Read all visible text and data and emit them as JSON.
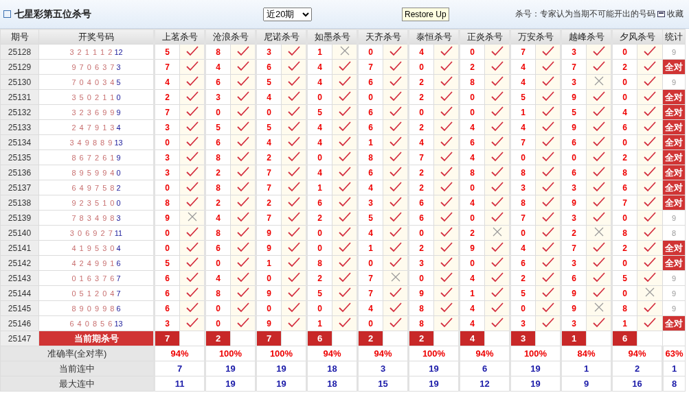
{
  "header": {
    "title": "七星彩第五位杀号",
    "period_select": "近20期",
    "restore_button": "Restore Up",
    "note": "杀号：专家认为当期不可能开出的号码",
    "favorite": "收藏"
  },
  "columns": {
    "period": "期号",
    "draw": "开奖号码",
    "experts": [
      "上茗杀号",
      "沧浪杀号",
      "尼诺杀号",
      "如墨杀号",
      "天齐杀号",
      "泰恒杀号",
      "正炎杀号",
      "万安杀号",
      "越峰杀号",
      "夕风杀号"
    ],
    "stats": "统计"
  },
  "rows": [
    {
      "period": "25128",
      "numbers": "3 2 1 1 1 2",
      "extra": "12",
      "picks": [
        {
          "kill": "5",
          "hit": true
        },
        {
          "kill": "8",
          "hit": true
        },
        {
          "kill": "3",
          "hit": true
        },
        {
          "kill": "1",
          "hit": false
        },
        {
          "kill": "0",
          "hit": true
        },
        {
          "kill": "4",
          "hit": true
        },
        {
          "kill": "0",
          "hit": true
        },
        {
          "kill": "7",
          "hit": true
        },
        {
          "kill": "3",
          "hit": true
        },
        {
          "kill": "0",
          "hit": true
        }
      ],
      "stat": {
        "kind": "count",
        "text": "9"
      }
    },
    {
      "period": "25129",
      "numbers": "9 7 0 6 3 7",
      "extra": "3",
      "picks": [
        {
          "kill": "7",
          "hit": true
        },
        {
          "kill": "4",
          "hit": true
        },
        {
          "kill": "6",
          "hit": true
        },
        {
          "kill": "4",
          "hit": true
        },
        {
          "kill": "7",
          "hit": true
        },
        {
          "kill": "0",
          "hit": true
        },
        {
          "kill": "2",
          "hit": true
        },
        {
          "kill": "4",
          "hit": true
        },
        {
          "kill": "7",
          "hit": true
        },
        {
          "kill": "2",
          "hit": true
        }
      ],
      "stat": {
        "kind": "full",
        "text": "全对"
      }
    },
    {
      "period": "25130",
      "numbers": "7 0 4 0 3 4",
      "extra": "5",
      "picks": [
        {
          "kill": "4",
          "hit": true
        },
        {
          "kill": "6",
          "hit": true
        },
        {
          "kill": "5",
          "hit": true
        },
        {
          "kill": "4",
          "hit": true
        },
        {
          "kill": "6",
          "hit": true
        },
        {
          "kill": "2",
          "hit": true
        },
        {
          "kill": "8",
          "hit": true
        },
        {
          "kill": "4",
          "hit": true
        },
        {
          "kill": "3",
          "hit": false
        },
        {
          "kill": "0",
          "hit": true
        }
      ],
      "stat": {
        "kind": "count",
        "text": "9"
      }
    },
    {
      "period": "25131",
      "numbers": "3 5 0 2 1 1",
      "extra": "0",
      "picks": [
        {
          "kill": "2",
          "hit": true
        },
        {
          "kill": "3",
          "hit": true
        },
        {
          "kill": "4",
          "hit": true
        },
        {
          "kill": "0",
          "hit": true
        },
        {
          "kill": "0",
          "hit": true
        },
        {
          "kill": "2",
          "hit": true
        },
        {
          "kill": "0",
          "hit": true
        },
        {
          "kill": "5",
          "hit": true
        },
        {
          "kill": "9",
          "hit": true
        },
        {
          "kill": "0",
          "hit": true
        }
      ],
      "stat": {
        "kind": "full",
        "text": "全对"
      }
    },
    {
      "period": "25132",
      "numbers": "3 2 3 6 9 9",
      "extra": "9",
      "picks": [
        {
          "kill": "7",
          "hit": true
        },
        {
          "kill": "0",
          "hit": true
        },
        {
          "kill": "0",
          "hit": true
        },
        {
          "kill": "5",
          "hit": true
        },
        {
          "kill": "6",
          "hit": true
        },
        {
          "kill": "0",
          "hit": true
        },
        {
          "kill": "0",
          "hit": true
        },
        {
          "kill": "1",
          "hit": true
        },
        {
          "kill": "5",
          "hit": true
        },
        {
          "kill": "4",
          "hit": true
        }
      ],
      "stat": {
        "kind": "full",
        "text": "全对"
      }
    },
    {
      "period": "25133",
      "numbers": "2 4 7 9 1 3",
      "extra": "4",
      "picks": [
        {
          "kill": "3",
          "hit": true
        },
        {
          "kill": "5",
          "hit": true
        },
        {
          "kill": "5",
          "hit": true
        },
        {
          "kill": "4",
          "hit": true
        },
        {
          "kill": "6",
          "hit": true
        },
        {
          "kill": "2",
          "hit": true
        },
        {
          "kill": "4",
          "hit": true
        },
        {
          "kill": "4",
          "hit": true
        },
        {
          "kill": "9",
          "hit": true
        },
        {
          "kill": "6",
          "hit": true
        }
      ],
      "stat": {
        "kind": "full",
        "text": "全对"
      }
    },
    {
      "period": "25134",
      "numbers": "3 4 9 8 8 9",
      "extra": "13",
      "picks": [
        {
          "kill": "0",
          "hit": true
        },
        {
          "kill": "6",
          "hit": true
        },
        {
          "kill": "4",
          "hit": true
        },
        {
          "kill": "4",
          "hit": true
        },
        {
          "kill": "1",
          "hit": true
        },
        {
          "kill": "4",
          "hit": true
        },
        {
          "kill": "6",
          "hit": true
        },
        {
          "kill": "7",
          "hit": true
        },
        {
          "kill": "6",
          "hit": true
        },
        {
          "kill": "0",
          "hit": true
        }
      ],
      "stat": {
        "kind": "full",
        "text": "全对"
      }
    },
    {
      "period": "25135",
      "numbers": "8 6 7 2 6 1",
      "extra": "9",
      "picks": [
        {
          "kill": "3",
          "hit": true
        },
        {
          "kill": "8",
          "hit": true
        },
        {
          "kill": "2",
          "hit": true
        },
        {
          "kill": "0",
          "hit": true
        },
        {
          "kill": "8",
          "hit": true
        },
        {
          "kill": "7",
          "hit": true
        },
        {
          "kill": "4",
          "hit": true
        },
        {
          "kill": "0",
          "hit": true
        },
        {
          "kill": "0",
          "hit": true
        },
        {
          "kill": "2",
          "hit": true
        }
      ],
      "stat": {
        "kind": "full",
        "text": "全对"
      }
    },
    {
      "period": "25136",
      "numbers": "8 9 5 9 9 4",
      "extra": "0",
      "picks": [
        {
          "kill": "3",
          "hit": true
        },
        {
          "kill": "2",
          "hit": true
        },
        {
          "kill": "7",
          "hit": true
        },
        {
          "kill": "4",
          "hit": true
        },
        {
          "kill": "6",
          "hit": true
        },
        {
          "kill": "2",
          "hit": true
        },
        {
          "kill": "8",
          "hit": true
        },
        {
          "kill": "8",
          "hit": true
        },
        {
          "kill": "6",
          "hit": true
        },
        {
          "kill": "8",
          "hit": true
        }
      ],
      "stat": {
        "kind": "full",
        "text": "全对"
      }
    },
    {
      "period": "25137",
      "numbers": "6 4 9 7 5 8",
      "extra": "2",
      "picks": [
        {
          "kill": "0",
          "hit": true
        },
        {
          "kill": "8",
          "hit": true
        },
        {
          "kill": "7",
          "hit": true
        },
        {
          "kill": "1",
          "hit": true
        },
        {
          "kill": "4",
          "hit": true
        },
        {
          "kill": "2",
          "hit": true
        },
        {
          "kill": "0",
          "hit": true
        },
        {
          "kill": "3",
          "hit": true
        },
        {
          "kill": "3",
          "hit": true
        },
        {
          "kill": "6",
          "hit": true
        }
      ],
      "stat": {
        "kind": "full",
        "text": "全对"
      }
    },
    {
      "period": "25138",
      "numbers": "9 2 3 5 1 0",
      "extra": "0",
      "picks": [
        {
          "kill": "8",
          "hit": true
        },
        {
          "kill": "2",
          "hit": true
        },
        {
          "kill": "2",
          "hit": true
        },
        {
          "kill": "6",
          "hit": true
        },
        {
          "kill": "3",
          "hit": true
        },
        {
          "kill": "6",
          "hit": true
        },
        {
          "kill": "4",
          "hit": true
        },
        {
          "kill": "8",
          "hit": true
        },
        {
          "kill": "9",
          "hit": true
        },
        {
          "kill": "7",
          "hit": true
        }
      ],
      "stat": {
        "kind": "full",
        "text": "全对"
      }
    },
    {
      "period": "25139",
      "numbers": "7 8 3 4 9 8",
      "extra": "3",
      "picks": [
        {
          "kill": "9",
          "hit": false
        },
        {
          "kill": "4",
          "hit": true
        },
        {
          "kill": "7",
          "hit": true
        },
        {
          "kill": "2",
          "hit": true
        },
        {
          "kill": "5",
          "hit": true
        },
        {
          "kill": "6",
          "hit": true
        },
        {
          "kill": "0",
          "hit": true
        },
        {
          "kill": "7",
          "hit": true
        },
        {
          "kill": "3",
          "hit": true
        },
        {
          "kill": "0",
          "hit": true
        }
      ],
      "stat": {
        "kind": "count",
        "text": "9"
      }
    },
    {
      "period": "25140",
      "numbers": "3 0 6 9 2 7",
      "extra": "11",
      "picks": [
        {
          "kill": "0",
          "hit": true
        },
        {
          "kill": "8",
          "hit": true
        },
        {
          "kill": "9",
          "hit": true
        },
        {
          "kill": "0",
          "hit": true
        },
        {
          "kill": "4",
          "hit": true
        },
        {
          "kill": "0",
          "hit": true
        },
        {
          "kill": "2",
          "hit": false
        },
        {
          "kill": "0",
          "hit": true
        },
        {
          "kill": "2",
          "hit": false
        },
        {
          "kill": "8",
          "hit": true
        }
      ],
      "stat": {
        "kind": "count",
        "text": "8"
      }
    },
    {
      "period": "25141",
      "numbers": "4 1 9 5 3 0",
      "extra": "4",
      "picks": [
        {
          "kill": "0",
          "hit": true
        },
        {
          "kill": "6",
          "hit": true
        },
        {
          "kill": "9",
          "hit": true
        },
        {
          "kill": "0",
          "hit": true
        },
        {
          "kill": "1",
          "hit": true
        },
        {
          "kill": "2",
          "hit": true
        },
        {
          "kill": "9",
          "hit": true
        },
        {
          "kill": "4",
          "hit": true
        },
        {
          "kill": "7",
          "hit": true
        },
        {
          "kill": "2",
          "hit": true
        }
      ],
      "stat": {
        "kind": "full",
        "text": "全对"
      }
    },
    {
      "period": "25142",
      "numbers": "4 2 4 9 9 1",
      "extra": "6",
      "picks": [
        {
          "kill": "5",
          "hit": true
        },
        {
          "kill": "0",
          "hit": true
        },
        {
          "kill": "1",
          "hit": true
        },
        {
          "kill": "8",
          "hit": true
        },
        {
          "kill": "0",
          "hit": true
        },
        {
          "kill": "3",
          "hit": true
        },
        {
          "kill": "0",
          "hit": true
        },
        {
          "kill": "6",
          "hit": true
        },
        {
          "kill": "3",
          "hit": true
        },
        {
          "kill": "0",
          "hit": true
        }
      ],
      "stat": {
        "kind": "full",
        "text": "全对"
      }
    },
    {
      "period": "25143",
      "numbers": "0 1 6 3 7 6",
      "extra": "7",
      "picks": [
        {
          "kill": "6",
          "hit": true
        },
        {
          "kill": "4",
          "hit": true
        },
        {
          "kill": "0",
          "hit": true
        },
        {
          "kill": "2",
          "hit": true
        },
        {
          "kill": "7",
          "hit": false
        },
        {
          "kill": "0",
          "hit": true
        },
        {
          "kill": "4",
          "hit": true
        },
        {
          "kill": "2",
          "hit": true
        },
        {
          "kill": "6",
          "hit": true
        },
        {
          "kill": "5",
          "hit": true
        }
      ],
      "stat": {
        "kind": "count",
        "text": "9"
      }
    },
    {
      "period": "25144",
      "numbers": "0 5 1 2 0 4",
      "extra": "7",
      "picks": [
        {
          "kill": "6",
          "hit": true
        },
        {
          "kill": "8",
          "hit": true
        },
        {
          "kill": "9",
          "hit": true
        },
        {
          "kill": "5",
          "hit": true
        },
        {
          "kill": "7",
          "hit": true
        },
        {
          "kill": "9",
          "hit": true
        },
        {
          "kill": "1",
          "hit": true
        },
        {
          "kill": "5",
          "hit": true
        },
        {
          "kill": "9",
          "hit": true
        },
        {
          "kill": "0",
          "hit": false
        }
      ],
      "stat": {
        "kind": "count",
        "text": "9"
      }
    },
    {
      "period": "25145",
      "numbers": "8 9 0 9 9 8",
      "extra": "6",
      "picks": [
        {
          "kill": "6",
          "hit": true
        },
        {
          "kill": "0",
          "hit": true
        },
        {
          "kill": "0",
          "hit": true
        },
        {
          "kill": "0",
          "hit": true
        },
        {
          "kill": "4",
          "hit": true
        },
        {
          "kill": "8",
          "hit": true
        },
        {
          "kill": "4",
          "hit": true
        },
        {
          "kill": "0",
          "hit": true
        },
        {
          "kill": "9",
          "hit": false
        },
        {
          "kill": "8",
          "hit": true
        }
      ],
      "stat": {
        "kind": "count",
        "text": "9"
      }
    },
    {
      "period": "25146",
      "numbers": "6 4 0 8 5 6",
      "extra": "13",
      "picks": [
        {
          "kill": "3",
          "hit": true
        },
        {
          "kill": "0",
          "hit": true
        },
        {
          "kill": "9",
          "hit": true
        },
        {
          "kill": "1",
          "hit": true
        },
        {
          "kill": "0",
          "hit": true
        },
        {
          "kill": "8",
          "hit": true
        },
        {
          "kill": "4",
          "hit": true
        },
        {
          "kill": "3",
          "hit": true
        },
        {
          "kill": "3",
          "hit": true
        },
        {
          "kill": "1",
          "hit": true
        }
      ],
      "stat": {
        "kind": "full",
        "text": "全对"
      }
    }
  ],
  "current": {
    "period": "25147",
    "label": "当前期杀号",
    "kills": [
      "7",
      "2",
      "7",
      "6",
      "2",
      "2",
      "4",
      "3",
      "1",
      "6"
    ]
  },
  "summary": [
    {
      "label": "准确率(全对率)",
      "kind": "rate",
      "values": [
        "94%",
        "100%",
        "100%",
        "94%",
        "94%",
        "100%",
        "94%",
        "100%",
        "84%",
        "94%"
      ],
      "total": "63%"
    },
    {
      "label": "当前连中",
      "kind": "streak",
      "values": [
        "7",
        "19",
        "19",
        "18",
        "3",
        "19",
        "6",
        "19",
        "1",
        "2"
      ],
      "total": "1"
    },
    {
      "label": "最大连中",
      "kind": "streak",
      "values": [
        "11",
        "19",
        "19",
        "18",
        "15",
        "19",
        "12",
        "19",
        "9",
        "16"
      ],
      "total": "8"
    }
  ]
}
